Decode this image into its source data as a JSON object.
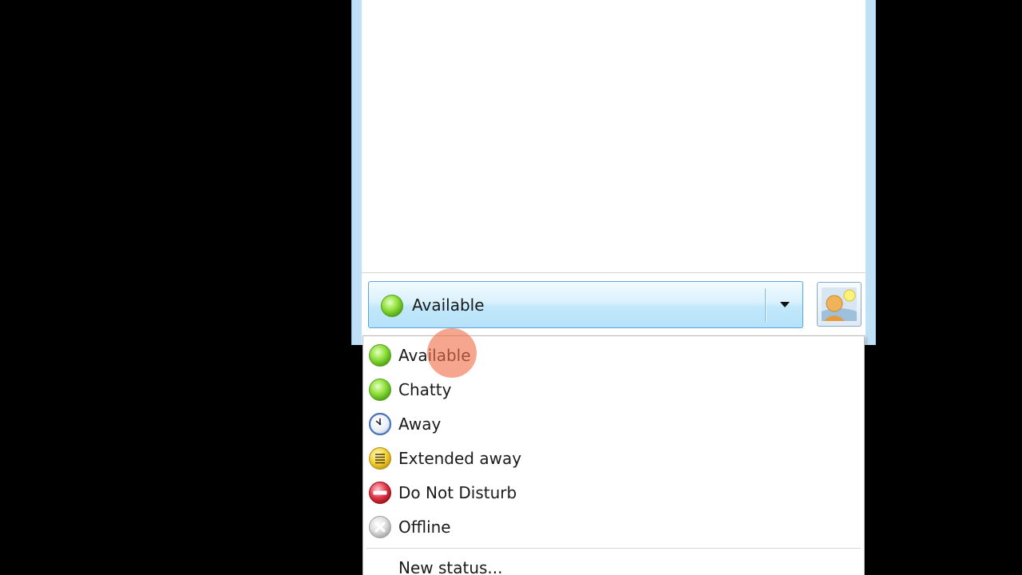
{
  "status_selector": {
    "current_status": "Available",
    "current_icon": "available-icon"
  },
  "avatar": {
    "icon": "avatar-icon"
  },
  "menu": {
    "items": [
      {
        "label": "Available",
        "icon": "available-icon"
      },
      {
        "label": "Chatty",
        "icon": "chatty-icon"
      },
      {
        "label": "Away",
        "icon": "away-clock-icon"
      },
      {
        "label": "Extended away",
        "icon": "extended-away-icon"
      },
      {
        "label": "Do Not Disturb",
        "icon": "do-not-disturb-icon"
      },
      {
        "label": "Offline",
        "icon": "offline-icon"
      }
    ],
    "new_status_label": "New status..."
  },
  "colors": {
    "available": "#8fe03a",
    "away": "#4a74b8",
    "extended_away": "#f2d43a",
    "do_not_disturb": "#e0384a",
    "offline": "#c9c9c9",
    "click_indicator": "#f06e4b"
  }
}
